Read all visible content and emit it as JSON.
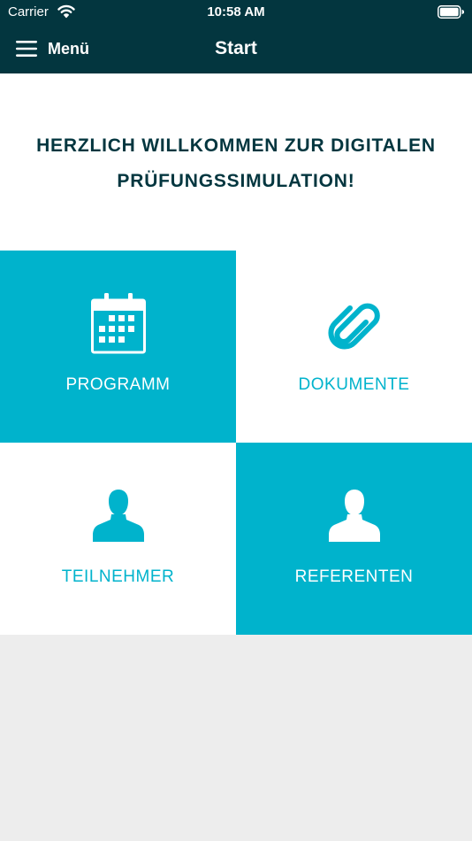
{
  "colors": {
    "header_background": "#03363f",
    "accent": "#00b3cc",
    "page_background": "#ededed"
  },
  "status_bar": {
    "carrier": "Carrier",
    "time": "10:58 AM",
    "wifi_icon": "wifi-icon",
    "battery_icon": "battery-icon"
  },
  "nav": {
    "menu_label": "Menü",
    "menu_icon": "hamburger-menu-icon",
    "title": "Start"
  },
  "welcome": {
    "line1": "HERZLICH WILLKOMMEN ZUR DIGITALEN",
    "line2": "PRÜFUNGSSIMULATION!"
  },
  "tiles": [
    {
      "label": "PROGRAMM",
      "icon": "calendar-icon",
      "filled": true
    },
    {
      "label": "DOKUMENTE",
      "icon": "paperclip-icon",
      "filled": false
    },
    {
      "label": "TEILNEHMER",
      "icon": "person-icon",
      "filled": false
    },
    {
      "label": "REFERENTEN",
      "icon": "person-icon",
      "filled": true
    }
  ]
}
